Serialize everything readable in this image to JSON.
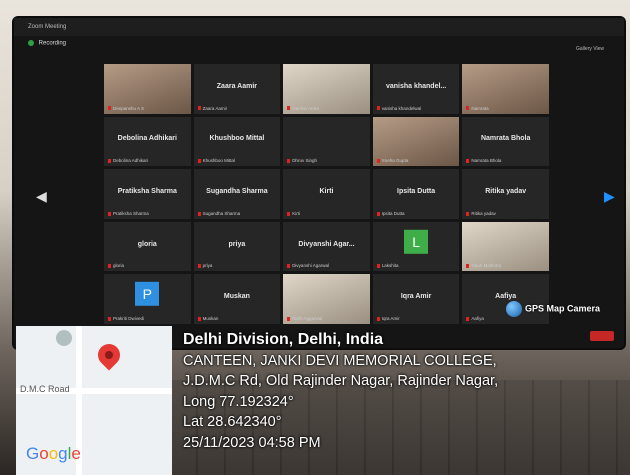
{
  "window": {
    "title": "Zoom Meeting",
    "recording": "Recording",
    "view_label": "Gallery View"
  },
  "participants": [
    {
      "name": "",
      "tag": "Deepanshu A S",
      "video": true
    },
    {
      "name": "Zaara Aamir",
      "tag": "Zaara Aamir",
      "video": false
    },
    {
      "name": "",
      "tag": "Garima Arora",
      "video": true,
      "light": true
    },
    {
      "name": "vanisha khandel...",
      "tag": "vanisha khandelwal",
      "video": false
    },
    {
      "name": "",
      "tag": "Namrata",
      "video": true
    },
    {
      "name": "Debolina Adhikari",
      "tag": "Debolina Adhikari",
      "video": false
    },
    {
      "name": "Khushboo Mittal",
      "tag": "Khushboo Mittal",
      "video": false
    },
    {
      "name": "",
      "tag": "Dhruv Singh",
      "video": false
    },
    {
      "name": "",
      "tag": "Sneha Gupta",
      "video": true
    },
    {
      "name": "Namrata Bhola",
      "tag": "Namrata Bhola",
      "video": false
    },
    {
      "name": "Pratiksha Sharma",
      "tag": "Pratiksha Sharma",
      "video": false
    },
    {
      "name": "Sugandha Sharma",
      "tag": "Sugandha Sharma",
      "video": false
    },
    {
      "name": "Kirti",
      "tag": "Kirti",
      "video": false
    },
    {
      "name": "Ipsita Dutta",
      "tag": "Ipsita Dutta",
      "video": false
    },
    {
      "name": "Ritika yadav",
      "tag": "Ritika yadav",
      "video": false
    },
    {
      "name": "gloria",
      "tag": "gloria",
      "video": false
    },
    {
      "name": "priya",
      "tag": "priya",
      "video": false
    },
    {
      "name": "Divyanshi Agar...",
      "tag": "Divyanshi Agarwal",
      "video": false
    },
    {
      "name": "",
      "tag": "Lakshita",
      "avatar": "L",
      "avatar_color": "#3fae49"
    },
    {
      "name": "",
      "tag": "Gauri Malhotra",
      "video": true,
      "light": true
    },
    {
      "name": "",
      "tag": "Prakriti Dwivedi",
      "avatar": "P",
      "avatar_color": "#2f8fe0"
    },
    {
      "name": "Muskan",
      "tag": "Muskan",
      "video": false
    },
    {
      "name": "",
      "tag": "Ridhi Aggarwal",
      "video": true,
      "light": true
    },
    {
      "name": "Iqra Amir",
      "tag": "Iqra Amir",
      "video": false
    },
    {
      "name": "Aafiya",
      "tag": "Aafiya",
      "video": false
    }
  ],
  "nav": {
    "left": "◀",
    "right": "▶"
  },
  "overlay": {
    "brand": "GPS Map Camera",
    "map_road": "D.M.C Road",
    "map_logo": "Google",
    "title": "Delhi Division, Delhi, India",
    "address1": "CANTEEN, JANKI DEVI MEMORIAL COLLEGE,",
    "address2": "J.D.M.C Rd, Old Rajinder Nagar, Rajinder Nagar,",
    "long": "Long 77.192324°",
    "lat": "Lat 28.642340°",
    "datetime": "25/11/2023 04:58 PM"
  },
  "colors": {
    "end_button": "#c62828",
    "pin": "#e53935"
  }
}
